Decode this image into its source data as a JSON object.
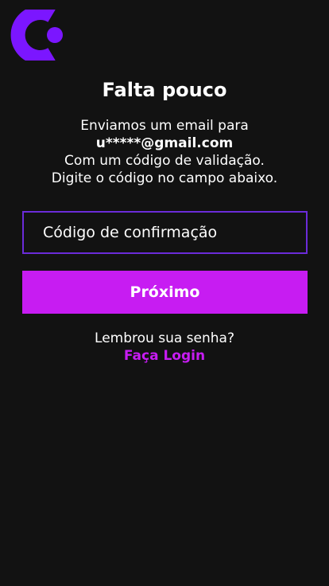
{
  "brand": {
    "logo_icon": "brand-logo-icon",
    "logo_color": "#7b16ff",
    "accent_color": "#c71cf2",
    "input_border_color": "#6b2bd9",
    "background_color": "#121212"
  },
  "title": "Falta pouco",
  "message": {
    "line1": "Enviamos um email para",
    "email": "u*****@gmail.com",
    "line3": "Com um código de validação.",
    "line4": "Digite o código no campo abaixo."
  },
  "code_input": {
    "placeholder": "Código de confirmação",
    "value": ""
  },
  "next_button": {
    "label": "Próximo"
  },
  "footer": {
    "prompt": "Lembrou sua senha?",
    "login_link": "Faça Login"
  }
}
